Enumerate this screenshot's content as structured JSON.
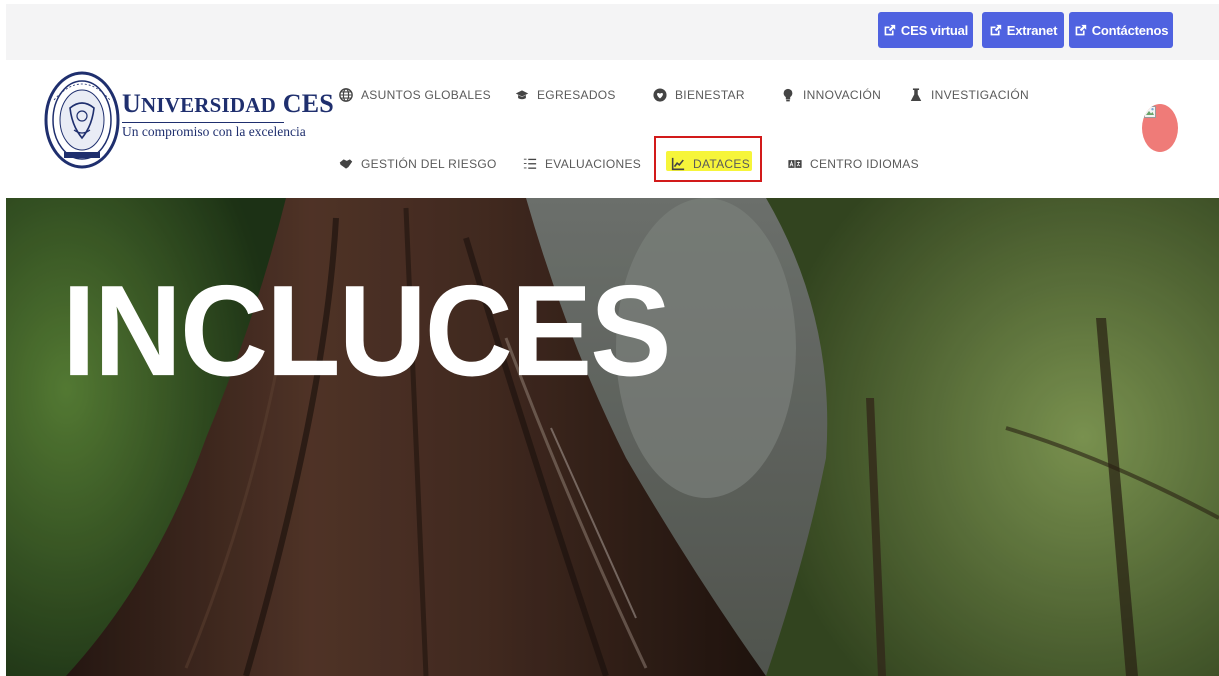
{
  "topbar": {
    "buttons": [
      {
        "label": "CES virtual",
        "icon": "external-link-icon"
      },
      {
        "label": "Extranet",
        "icon": "external-link-icon"
      },
      {
        "label": "Contáctenos",
        "icon": "external-link-icon"
      }
    ],
    "button_color": "#4f62e0"
  },
  "brand": {
    "name_first": "U",
    "name_rest": "NIVERSIDAD",
    "name_ces": "CES",
    "tagline": "Un compromiso con la excelencia",
    "color": "#1f2f6e"
  },
  "nav": {
    "row1": [
      {
        "label": "Asuntos Globales",
        "icon": "globe-icon"
      },
      {
        "label": "Egresados",
        "icon": "graduation-cap-icon"
      },
      {
        "label": "Bienestar",
        "icon": "heart-icon"
      },
      {
        "label": "Innovación",
        "icon": "lightbulb-icon"
      },
      {
        "label": "Investigación",
        "icon": "flask-icon"
      }
    ],
    "row2": [
      {
        "label": "Gestión del Riesgo",
        "icon": "handshake-icon"
      },
      {
        "label": "Evaluaciones",
        "icon": "list-icon"
      },
      {
        "label": "DATACES",
        "icon": "chart-line-icon",
        "highlighted": true
      },
      {
        "label": "Centro Idiomas",
        "icon": "language-icon"
      }
    ]
  },
  "avatar": {
    "color": "#ef7b78"
  },
  "hero": {
    "title": "INCLUCES"
  }
}
